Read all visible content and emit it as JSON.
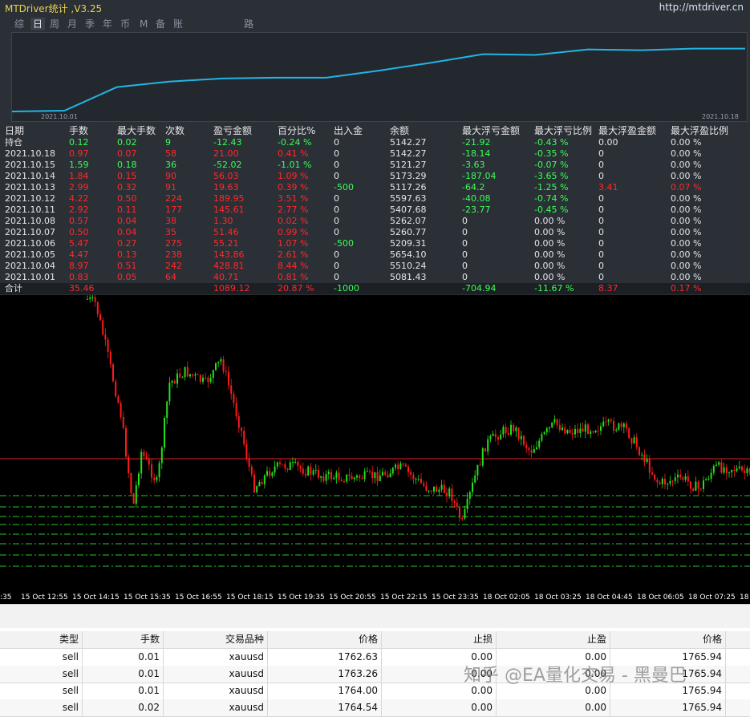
{
  "app": {
    "title": "MTDriver统计 ,V3.25",
    "url": "http://mtdriver.cn",
    "tabs": [
      "综",
      "日",
      "周",
      "月",
      "季",
      "年",
      "币",
      "M",
      "备",
      "账户",
      "路径"
    ],
    "active_tab": "日"
  },
  "equity_curve": {
    "start_label": "2021.10.01",
    "end_label": "2021.10.18",
    "color": "#22b5e6",
    "values": [
      0.02,
      0.03,
      0.33,
      0.4,
      0.44,
      0.45,
      0.45,
      0.54,
      0.64,
      0.75,
      0.74,
      0.81,
      0.8,
      0.82,
      0.82
    ]
  },
  "stats_table": {
    "headers": [
      "日期",
      "手数",
      "最大手数",
      "次数",
      "盈亏金额",
      "百分比%",
      "出入金",
      "余额",
      "最大浮亏金额",
      "最大浮亏比例",
      "最大浮盈金额",
      "最大浮盈比例"
    ],
    "rows": [
      {
        "c": [
          "持仓",
          "0.12",
          "0.02",
          "9",
          "-12.43",
          "-0.24 %",
          "0",
          "5142.27",
          "-21.92",
          "-0.43 %",
          "0.00",
          "0.00 %"
        ],
        "k": [
          "w",
          "g",
          "g",
          "g",
          "g",
          "g",
          "w",
          "w",
          "g",
          "g",
          "w",
          "w"
        ]
      },
      {
        "c": [
          "2021.10.18",
          "0.97",
          "0.07",
          "58",
          "21.00",
          "0.41 %",
          "0",
          "5142.27",
          "-18.14",
          "-0.35 %",
          "0",
          "0.00 %"
        ],
        "k": [
          "w",
          "r",
          "r",
          "r",
          "r",
          "r",
          "w",
          "w",
          "g",
          "g",
          "w",
          "w"
        ]
      },
      {
        "c": [
          "2021.10.15",
          "1.59",
          "0.18",
          "36",
          "-52.02",
          "-1.01 %",
          "0",
          "5121.27",
          "-3.63",
          "-0.07 %",
          "0",
          "0.00 %"
        ],
        "k": [
          "w",
          "g",
          "g",
          "g",
          "g",
          "g",
          "w",
          "w",
          "g",
          "g",
          "w",
          "w"
        ]
      },
      {
        "c": [
          "2021.10.14",
          "1.84",
          "0.15",
          "90",
          "56.03",
          "1.09 %",
          "0",
          "5173.29",
          "-187.04",
          "-3.65 %",
          "0",
          "0.00 %"
        ],
        "k": [
          "w",
          "r",
          "r",
          "r",
          "r",
          "r",
          "w",
          "w",
          "g",
          "g",
          "w",
          "w"
        ]
      },
      {
        "c": [
          "2021.10.13",
          "2.99",
          "0.32",
          "91",
          "19.63",
          "0.39 %",
          "-500",
          "5117.26",
          "-64.2",
          "-1.25 %",
          "3.41",
          "0.07 %"
        ],
        "k": [
          "w",
          "r",
          "r",
          "r",
          "r",
          "r",
          "g",
          "w",
          "g",
          "g",
          "r",
          "r"
        ]
      },
      {
        "c": [
          "2021.10.12",
          "4.22",
          "0.50",
          "224",
          "189.95",
          "3.51 %",
          "0",
          "5597.63",
          "-40.08",
          "-0.74 %",
          "0",
          "0.00 %"
        ],
        "k": [
          "w",
          "r",
          "r",
          "r",
          "r",
          "r",
          "w",
          "w",
          "g",
          "g",
          "w",
          "w"
        ]
      },
      {
        "c": [
          "2021.10.11",
          "2.92",
          "0.11",
          "177",
          "145.61",
          "2.77 %",
          "0",
          "5407.68",
          "-23.77",
          "-0.45 %",
          "0",
          "0.00 %"
        ],
        "k": [
          "w",
          "r",
          "r",
          "r",
          "r",
          "r",
          "w",
          "w",
          "g",
          "g",
          "w",
          "w"
        ]
      },
      {
        "c": [
          "2021.10.08",
          "0.57",
          "0.04",
          "38",
          "1.30",
          "0.02 %",
          "0",
          "5262.07",
          "0",
          "0.00 %",
          "0",
          "0.00 %"
        ],
        "k": [
          "w",
          "r",
          "r",
          "r",
          "r",
          "r",
          "w",
          "w",
          "w",
          "w",
          "w",
          "w"
        ]
      },
      {
        "c": [
          "2021.10.07",
          "0.50",
          "0.04",
          "35",
          "51.46",
          "0.99 %",
          "0",
          "5260.77",
          "0",
          "0.00 %",
          "0",
          "0.00 %"
        ],
        "k": [
          "w",
          "r",
          "r",
          "r",
          "r",
          "r",
          "w",
          "w",
          "w",
          "w",
          "w",
          "w"
        ]
      },
      {
        "c": [
          "2021.10.06",
          "5.47",
          "0.27",
          "275",
          "55.21",
          "1.07 %",
          "-500",
          "5209.31",
          "0",
          "0.00 %",
          "0",
          "0.00 %"
        ],
        "k": [
          "w",
          "r",
          "r",
          "r",
          "r",
          "r",
          "g",
          "w",
          "w",
          "w",
          "w",
          "w"
        ]
      },
      {
        "c": [
          "2021.10.05",
          "4.47",
          "0.13",
          "238",
          "143.86",
          "2.61 %",
          "0",
          "5654.10",
          "0",
          "0.00 %",
          "0",
          "0.00 %"
        ],
        "k": [
          "w",
          "r",
          "r",
          "r",
          "r",
          "r",
          "w",
          "w",
          "w",
          "w",
          "w",
          "w"
        ]
      },
      {
        "c": [
          "2021.10.04",
          "8.97",
          "0.51",
          "242",
          "428.81",
          "8.44 %",
          "0",
          "5510.24",
          "0",
          "0.00 %",
          "0",
          "0.00 %"
        ],
        "k": [
          "w",
          "r",
          "r",
          "r",
          "r",
          "r",
          "w",
          "w",
          "w",
          "w",
          "w",
          "w"
        ]
      },
      {
        "c": [
          "2021.10.01",
          "0.83",
          "0.05",
          "64",
          "40.71",
          "0.81 %",
          "0",
          "5081.43",
          "0",
          "0.00 %",
          "0",
          "0.00 %"
        ],
        "k": [
          "w",
          "r",
          "r",
          "r",
          "r",
          "r",
          "w",
          "w",
          "w",
          "w",
          "w",
          "w"
        ]
      }
    ],
    "total": {
      "c": [
        "合计",
        "35.46",
        "",
        "",
        "1089.12",
        "20.87 %",
        "-1000",
        "",
        "-704.94",
        "-11.67 %",
        "8.37",
        "0.17 %"
      ],
      "k": [
        "w",
        "r",
        "w",
        "w",
        "r",
        "r",
        "g",
        "w",
        "g",
        "g",
        "r",
        "r"
      ]
    }
  },
  "price_chart": {
    "bull_color": "#22e01a",
    "bear_color": "#ff1a1a",
    "resistance_color": "#e02020",
    "level_color": "#2ec42e",
    "time_labels": [
      ":35",
      "15 Oct 12:55",
      "15 Oct 14:15",
      "15 Oct 15:35",
      "15 Oct 16:55",
      "15 Oct 18:15",
      "15 Oct 19:35",
      "15 Oct 20:55",
      "15 Oct 22:15",
      "15 Oct 23:35",
      "18 Oct 02:05",
      "18 Oct 03:25",
      "18 Oct 04:45",
      "18 Oct 06:05",
      "18 Oct 07:25",
      "18"
    ]
  },
  "orders": {
    "headers": [
      "类型",
      "手数",
      "交易品种",
      "价格",
      "止损",
      "止盈",
      "价格"
    ],
    "rows": [
      [
        "sell",
        "0.01",
        "xauusd",
        "1762.63",
        "0.00",
        "0.00",
        "1765.94"
      ],
      [
        "sell",
        "0.01",
        "xauusd",
        "1763.26",
        "0.00",
        "0.00",
        "1765.94"
      ],
      [
        "sell",
        "0.01",
        "xauusd",
        "1764.00",
        "0.00",
        "0.00",
        "1765.94"
      ],
      [
        "sell",
        "0.02",
        "xauusd",
        "1764.54",
        "0.00",
        "0.00",
        "1765.94"
      ]
    ]
  },
  "watermark": "知乎 @EA量化交易 - 黑曼巴"
}
